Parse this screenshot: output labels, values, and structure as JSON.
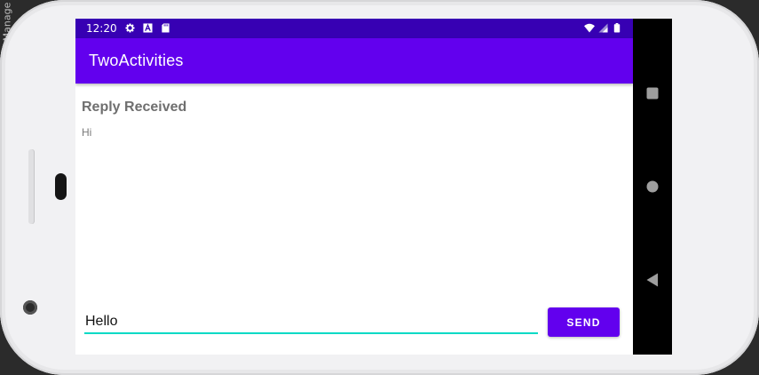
{
  "desktop": {
    "edge_text": "Manage"
  },
  "status_bar": {
    "time": "12:20",
    "left_icons": [
      "gear-icon",
      "a-box-icon",
      "sd-card-icon"
    ],
    "right_icons": [
      "wifi-icon",
      "signal-icon",
      "battery-icon"
    ]
  },
  "app_bar": {
    "title": "TwoActivities"
  },
  "content": {
    "reply_header": "Reply Received",
    "reply_text": "Hi"
  },
  "composer": {
    "input_value": "Hello",
    "send_label": "SEND"
  },
  "navigation": {
    "buttons": [
      "overview-square-icon",
      "home-circle-icon",
      "back-triangle-icon"
    ]
  },
  "colors": {
    "status_bar": "#3700b3",
    "primary": "#6200ee",
    "accent": "#03dac5",
    "nav_bar": "#000000"
  }
}
